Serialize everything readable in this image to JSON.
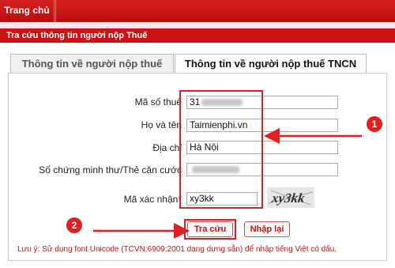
{
  "topnav": {
    "home_label": "Trang chủ"
  },
  "section": {
    "title": "Tra cứu thông tin người nộp Thuế"
  },
  "tabs": [
    {
      "label": "Thông tin về người nộp thuế",
      "active": false
    },
    {
      "label": "Thông tin về người nộp thuế TNCN",
      "active": true
    }
  ],
  "form": {
    "tax_code": {
      "label": "Mã số thuế",
      "value": "31"
    },
    "full_name": {
      "label": "Họ và tên",
      "value": "Taimienphi.vn"
    },
    "address": {
      "label": "Địa chỉ",
      "value": "Hà Nội"
    },
    "id_number": {
      "label": "Số chứng minh thư/Thẻ căn cước",
      "value": ""
    },
    "captcha": {
      "label": "Mã xác nhận",
      "required_mark": "*",
      "value": "xy3kk",
      "image_text": "xy3kk"
    }
  },
  "buttons": {
    "search_label": "Tra cứu",
    "reset_label": "Nhập lại"
  },
  "annotations": {
    "badge1": "1",
    "badge2": "2",
    "color": "#e02020"
  },
  "note": "Lưu ý: Sử dụng font Unicode (TCVN:6909:2001 dạng dựng sẵn) để nhập tiếng Việt có dấu."
}
